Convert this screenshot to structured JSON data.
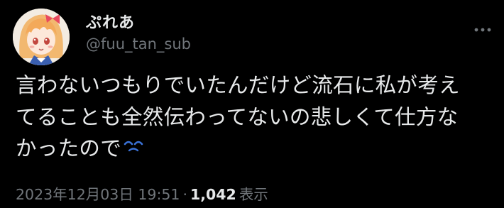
{
  "author": {
    "display_name": "ぷれあ",
    "handle": "@fuu_tan_sub",
    "avatar_icon": "anime-girl-avatar"
  },
  "tweet": {
    "text_lines": [
      "言わないつもりでいたんだけど流石に私が考え",
      "てることも全然伝わってないの悲しくて仕方な",
      "かったので"
    ],
    "emoji": "sad-face-emoji"
  },
  "meta": {
    "timestamp": "2023年12月03日 19:51",
    "separator": "·",
    "views_count": "1,042",
    "views_label": "表示"
  },
  "colors": {
    "background": "#000000",
    "text_primary": "#e7e9ea",
    "text_secondary": "#71767b",
    "emoji_blue": "#3b73d9"
  }
}
